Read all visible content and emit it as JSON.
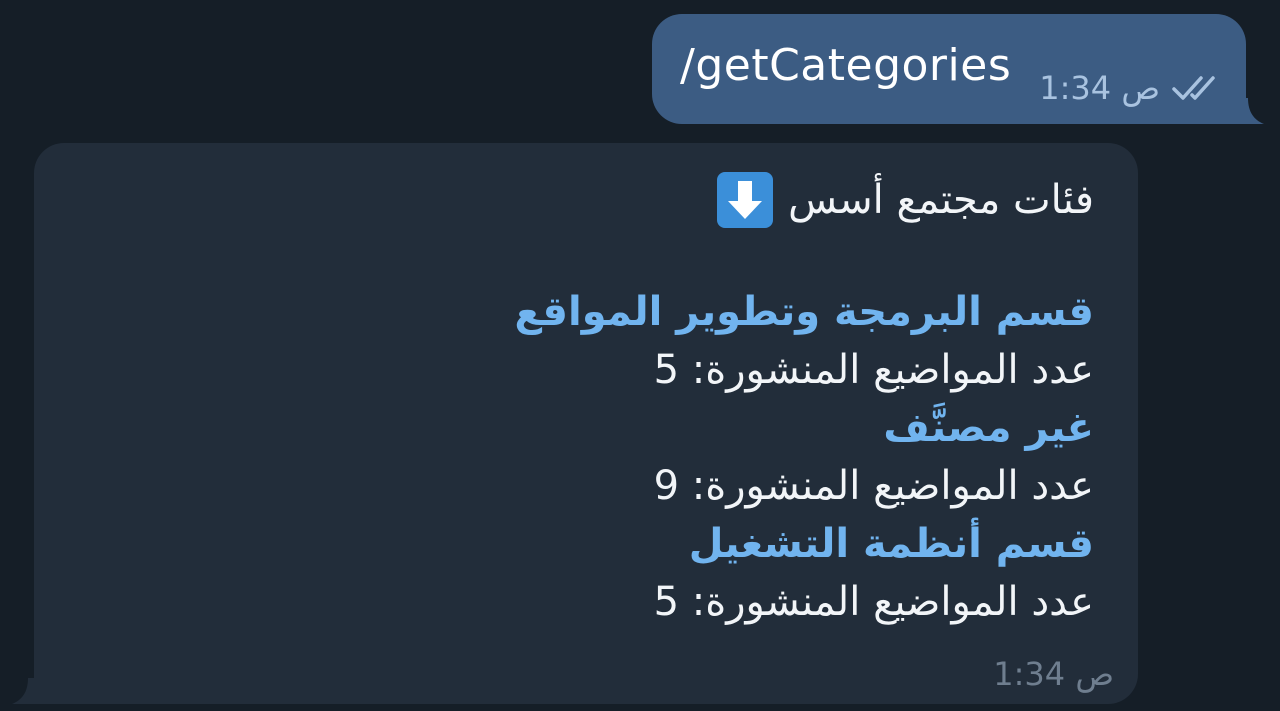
{
  "outgoing": {
    "text": "/getCategories",
    "time": "1:34 ص",
    "status_icon": "double-check-icon"
  },
  "incoming": {
    "header_text": "فئات مجتمع أسس",
    "header_icon": "down-arrow-emoji-icon",
    "categories": [
      {
        "name": "قسم البرمجة وتطوير المواقع",
        "count_text": "عدد المواضيع المنشورة: 5"
      },
      {
        "name": "غير مصنَّف",
        "count_text": "عدد المواضيع المنشورة: 9"
      },
      {
        "name": "قسم أنظمة التشغيل",
        "count_text": "عدد المواضيع المنشورة: 5"
      }
    ],
    "time": "1:34 ص"
  },
  "colors": {
    "background": "#151e27",
    "outgoing_bubble": "#3c5c83",
    "incoming_bubble": "#222d3a",
    "category_link": "#71b4ef",
    "arrow_emoji": "#3b8fd9"
  }
}
